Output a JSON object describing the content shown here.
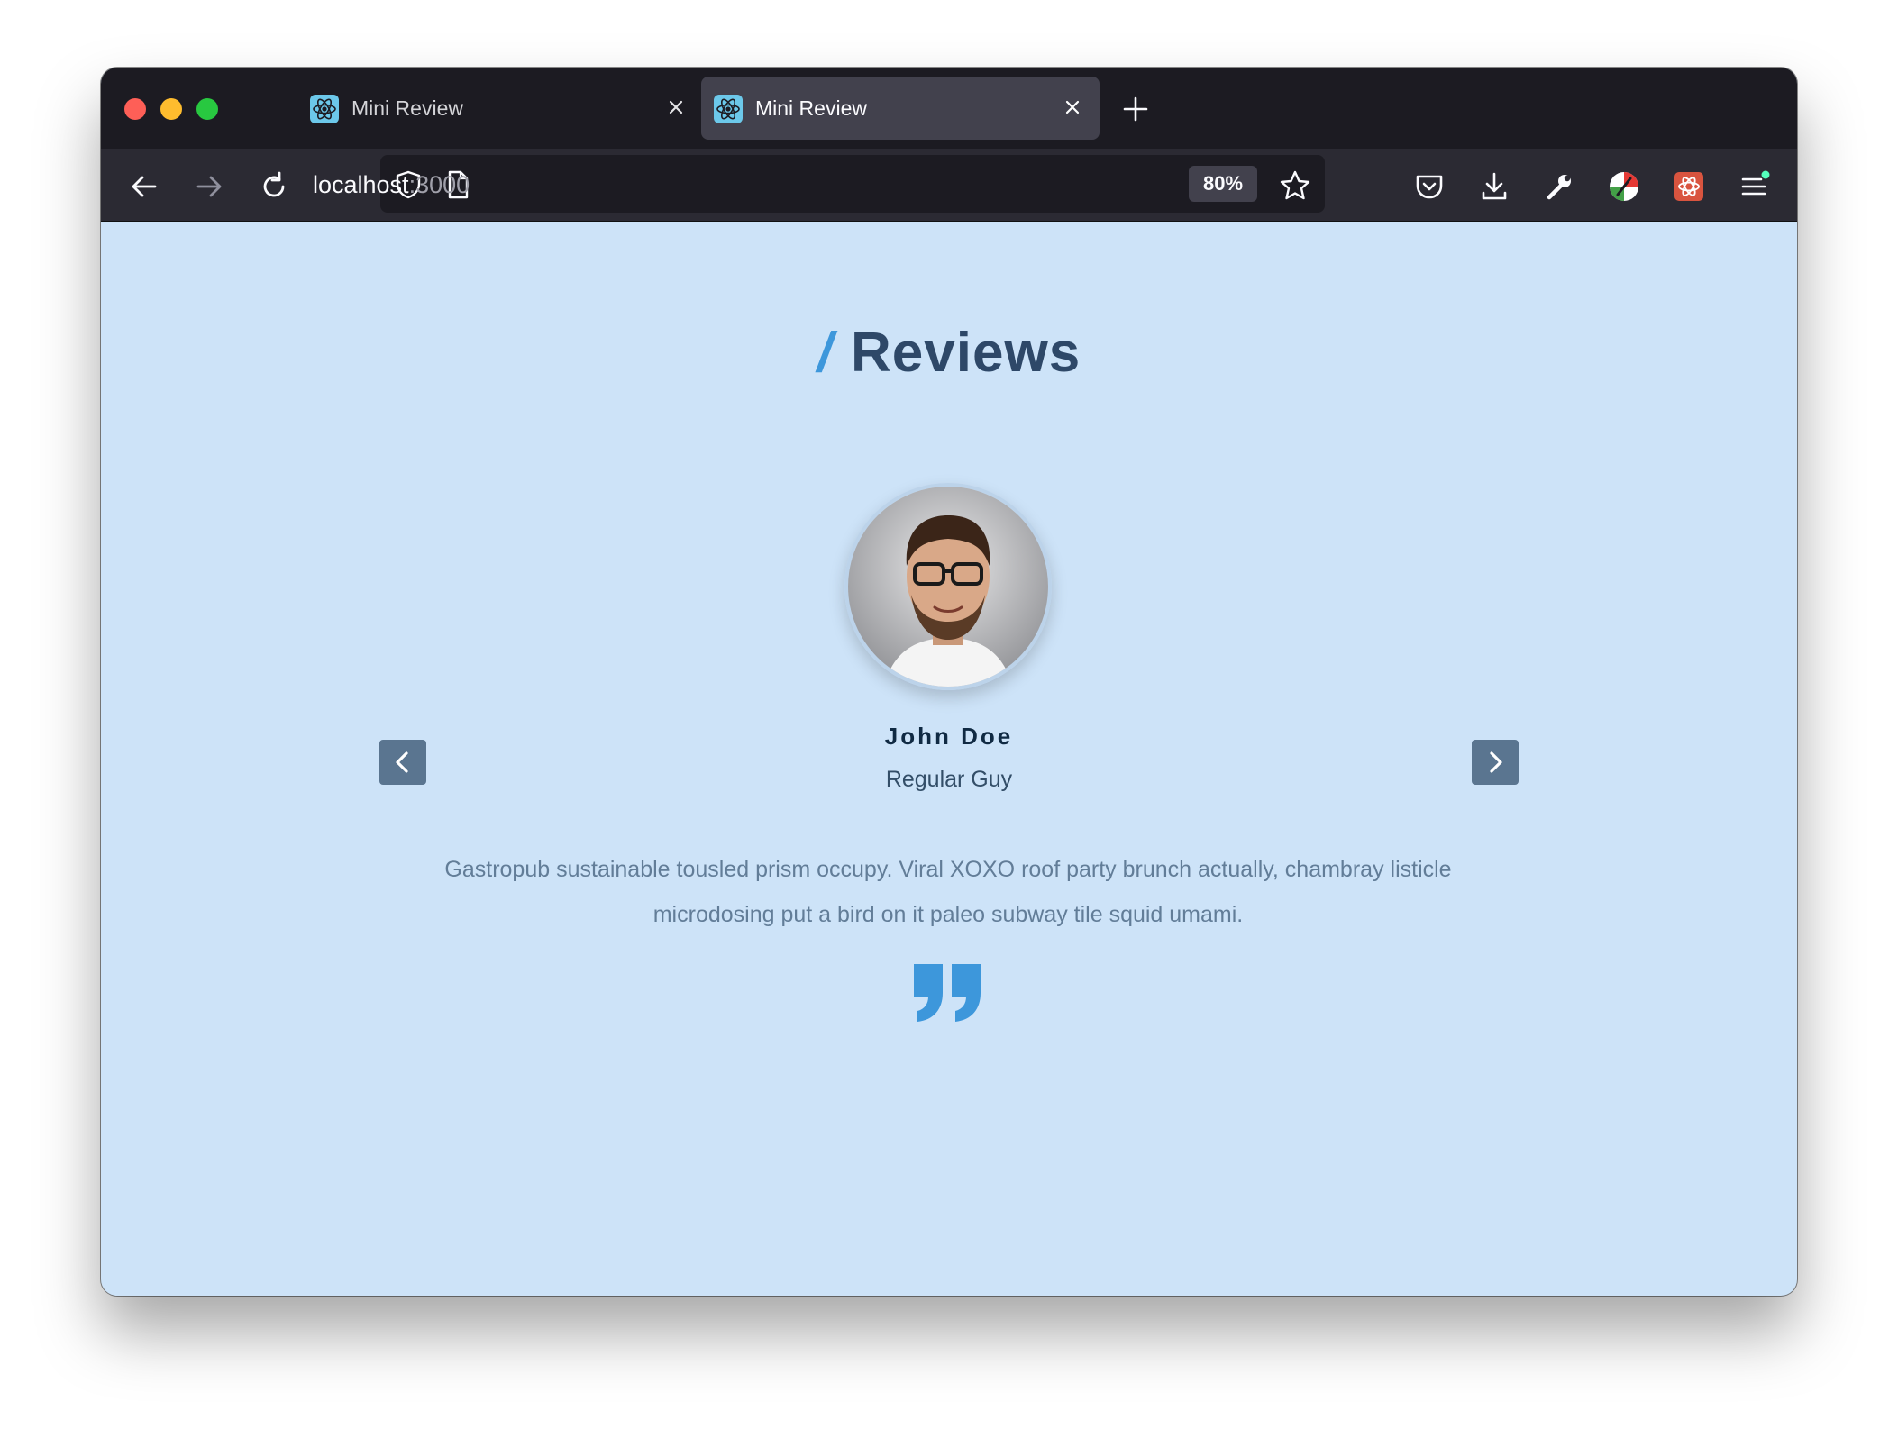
{
  "browser": {
    "tabs": [
      {
        "title": "Mini Review",
        "active": false
      },
      {
        "title": "Mini Review",
        "active": true
      }
    ],
    "url_host": "localhost",
    "url_port": ":3000",
    "zoom": "80%"
  },
  "page": {
    "title_slash": "/",
    "title": "Reviews",
    "review": {
      "name": "John Doe",
      "job": "Regular Guy",
      "text": "Gastropub sustainable tousled prism occupy. Viral XOXO roof party brunch actually, chambray listicle microdosing put a bird on it paleo subway tile squid umami."
    }
  },
  "colors": {
    "background": "#cde3f8",
    "accent": "#3d97db",
    "title": "#2e4868",
    "button": "#5a7590"
  }
}
